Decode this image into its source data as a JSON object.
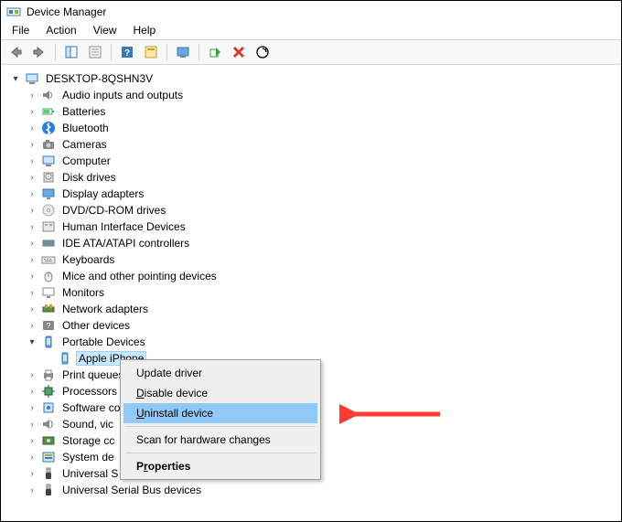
{
  "window": {
    "title": "Device Manager"
  },
  "menu": {
    "file": "File",
    "action": "Action",
    "view": "View",
    "help": "Help"
  },
  "root": {
    "name": "DESKTOP-8QSHN3V"
  },
  "categories": [
    {
      "label": "Audio inputs and outputs",
      "icon": "speaker"
    },
    {
      "label": "Batteries",
      "icon": "battery"
    },
    {
      "label": "Bluetooth",
      "icon": "bluetooth"
    },
    {
      "label": "Cameras",
      "icon": "camera"
    },
    {
      "label": "Computer",
      "icon": "computer"
    },
    {
      "label": "Disk drives",
      "icon": "disk"
    },
    {
      "label": "Display adapters",
      "icon": "display"
    },
    {
      "label": "DVD/CD-ROM drives",
      "icon": "dvd"
    },
    {
      "label": "Human Interface Devices",
      "icon": "hid"
    },
    {
      "label": "IDE ATA/ATAPI controllers",
      "icon": "ide"
    },
    {
      "label": "Keyboards",
      "icon": "keyboard"
    },
    {
      "label": "Mice and other pointing devices",
      "icon": "mouse"
    },
    {
      "label": "Monitors",
      "icon": "monitor"
    },
    {
      "label": "Network adapters",
      "icon": "network"
    },
    {
      "label": "Other devices",
      "icon": "other"
    },
    {
      "label": "Portable Devices",
      "icon": "portable",
      "expanded": true,
      "children": [
        {
          "label": "Apple iPhone",
          "icon": "portable",
          "selected": true
        }
      ]
    },
    {
      "label": "Print queues",
      "icon": "printer"
    },
    {
      "label": "Processors",
      "icon": "cpu"
    },
    {
      "label": "Software components",
      "icon": "software"
    },
    {
      "label": "Sound, video and game controllers",
      "icon": "sound",
      "truncated": "Sound, vic"
    },
    {
      "label": "Storage controllers",
      "icon": "storage",
      "truncated": "Storage cc"
    },
    {
      "label": "System devices",
      "icon": "system",
      "truncated": "System de"
    },
    {
      "label": "Universal Serial Bus controllers",
      "icon": "usb",
      "truncated": "Universal S"
    },
    {
      "label": "Universal Serial Bus devices",
      "icon": "usb"
    }
  ],
  "context_menu": {
    "update": "Update driver",
    "disable": "Disable device",
    "uninstall": "Uninstall device",
    "scan": "Scan for hardware changes",
    "properties": "Properties"
  }
}
